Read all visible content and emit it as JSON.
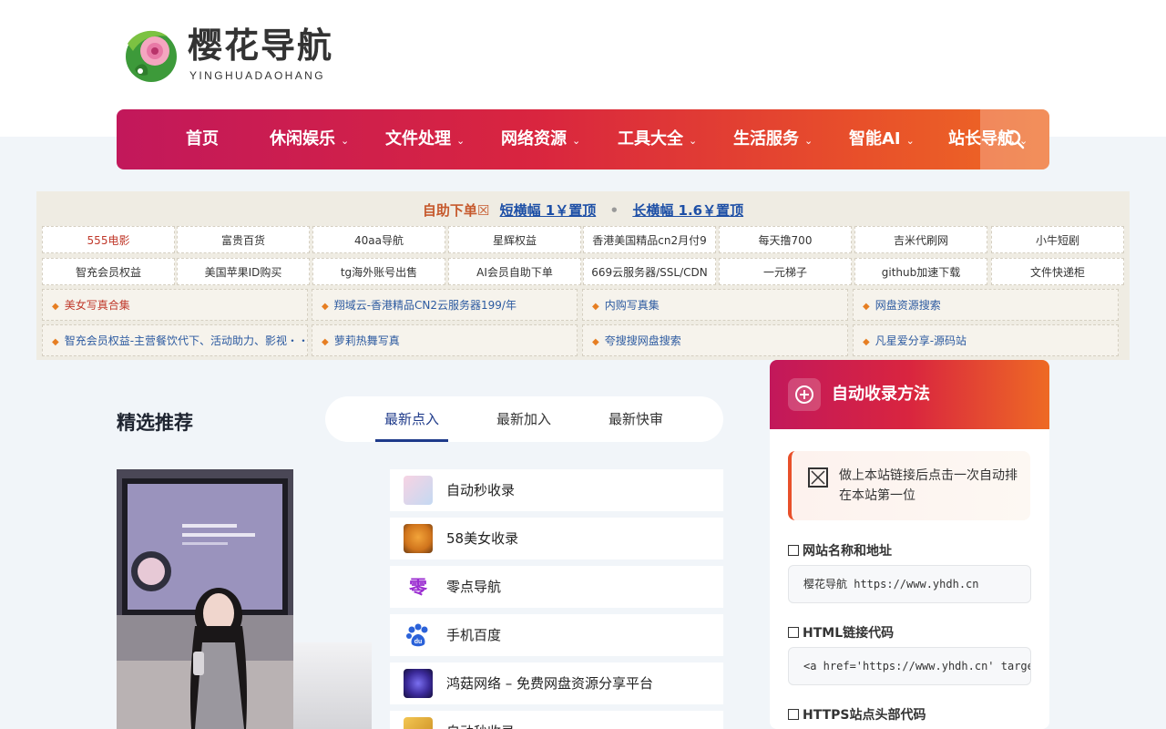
{
  "logo": {
    "title": "樱花导航",
    "subtitle": "YINGHUADAOHANG"
  },
  "nav": {
    "items": [
      {
        "label": "首页",
        "chevron": false
      },
      {
        "label": "休闲娱乐",
        "chevron": true
      },
      {
        "label": "文件处理",
        "chevron": true
      },
      {
        "label": "网络资源",
        "chevron": true
      },
      {
        "label": "工具大全",
        "chevron": true
      },
      {
        "label": "生活服务",
        "chevron": true
      },
      {
        "label": "智能AI",
        "chevron": true
      },
      {
        "label": "站长导航",
        "chevron": true
      }
    ],
    "search_icon": "search-icon"
  },
  "ads": {
    "head_a": "自助下单☒",
    "head_b": "短横幅 1￥置顶",
    "head_dot": "•",
    "head_c": "长横幅 1.6￥置顶",
    "row1": [
      "555电影",
      "富贵百货",
      "40aa导航",
      "星辉权益",
      "香港美国精品cn2月付9",
      "每天撸700",
      "吉米代刷网",
      "小牛短剧"
    ],
    "row2": [
      "智充会员权益",
      "美国苹果ID购买",
      "tg海外账号出售",
      "AI会员自助下单",
      "669云服务器/SSL/CDN",
      "一元梯子",
      "github加速下载",
      "文件快递柜"
    ],
    "row3": [
      "美女写真合集",
      "翔域云-香港精品CN2云服务器199/年",
      "内购写真集",
      "网盘资源搜索"
    ],
    "row4": [
      "智充会员权益-主营餐饮代下、活动助力、影视・・",
      "萝莉热舞写真",
      "夸搜搜网盘搜索",
      "凡星爱分享-源码站"
    ]
  },
  "featured": {
    "title": "精选推荐",
    "tabs": [
      "最新点入",
      "最新加入",
      "最新快审"
    ],
    "active_tab": 0
  },
  "list": [
    {
      "label": "自动秒收录",
      "icon": "sakura-icon"
    },
    {
      "label": "58美女收录",
      "icon": "tiger-icon"
    },
    {
      "label": "零点导航",
      "icon": "zero-glyph-icon"
    },
    {
      "label": "手机百度",
      "icon": "baidu-paw-icon"
    },
    {
      "label": "鸿菇网络 – 免费网盘资源分享平台",
      "icon": "neon-logo-icon"
    },
    {
      "label": "自动秒收录",
      "icon": "gold-logo-icon"
    }
  ],
  "side": {
    "title": "自动收录方法",
    "tip": "做上本站链接后点击一次自动排在本站第一位",
    "fields": [
      {
        "label": "网站名称和地址",
        "value": "樱花导航 https://www.yhdh.cn"
      },
      {
        "label": "HTML链接代码",
        "value": "<a href='https://www.yhdh.cn' target='_blank'>樱花导航</a>"
      },
      {
        "label": "HTTPS站点头部代码",
        "value": ""
      }
    ]
  },
  "colors": {
    "accent_start": "#c2185b",
    "accent_end": "#ee6a24",
    "tab_active": "#1e3a8a"
  }
}
